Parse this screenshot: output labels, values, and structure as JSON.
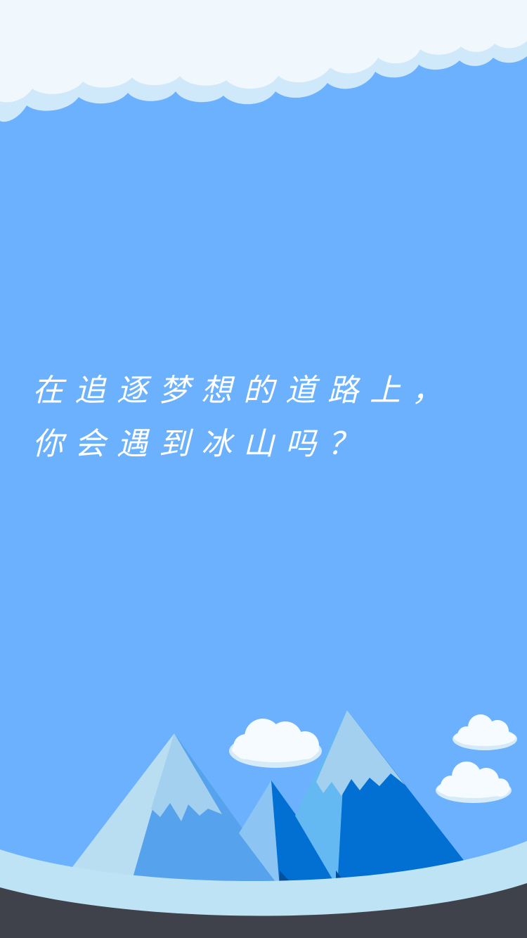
{
  "headline": {
    "line1": "在追逐梦想的道路上，",
    "line2": "你会遇到冰山吗？"
  },
  "colors": {
    "sky": "#6bb1fd",
    "cloud_light": "#f0f8fd",
    "cloud_shadow": "#cfe9fb",
    "snow": "#b9def2",
    "ground": "#bde3f5",
    "floor": "#3f424b",
    "mountain_light": "#56a2ec",
    "mountain_dark": "#0270d2",
    "mountain_mid": "#64b9f2"
  }
}
